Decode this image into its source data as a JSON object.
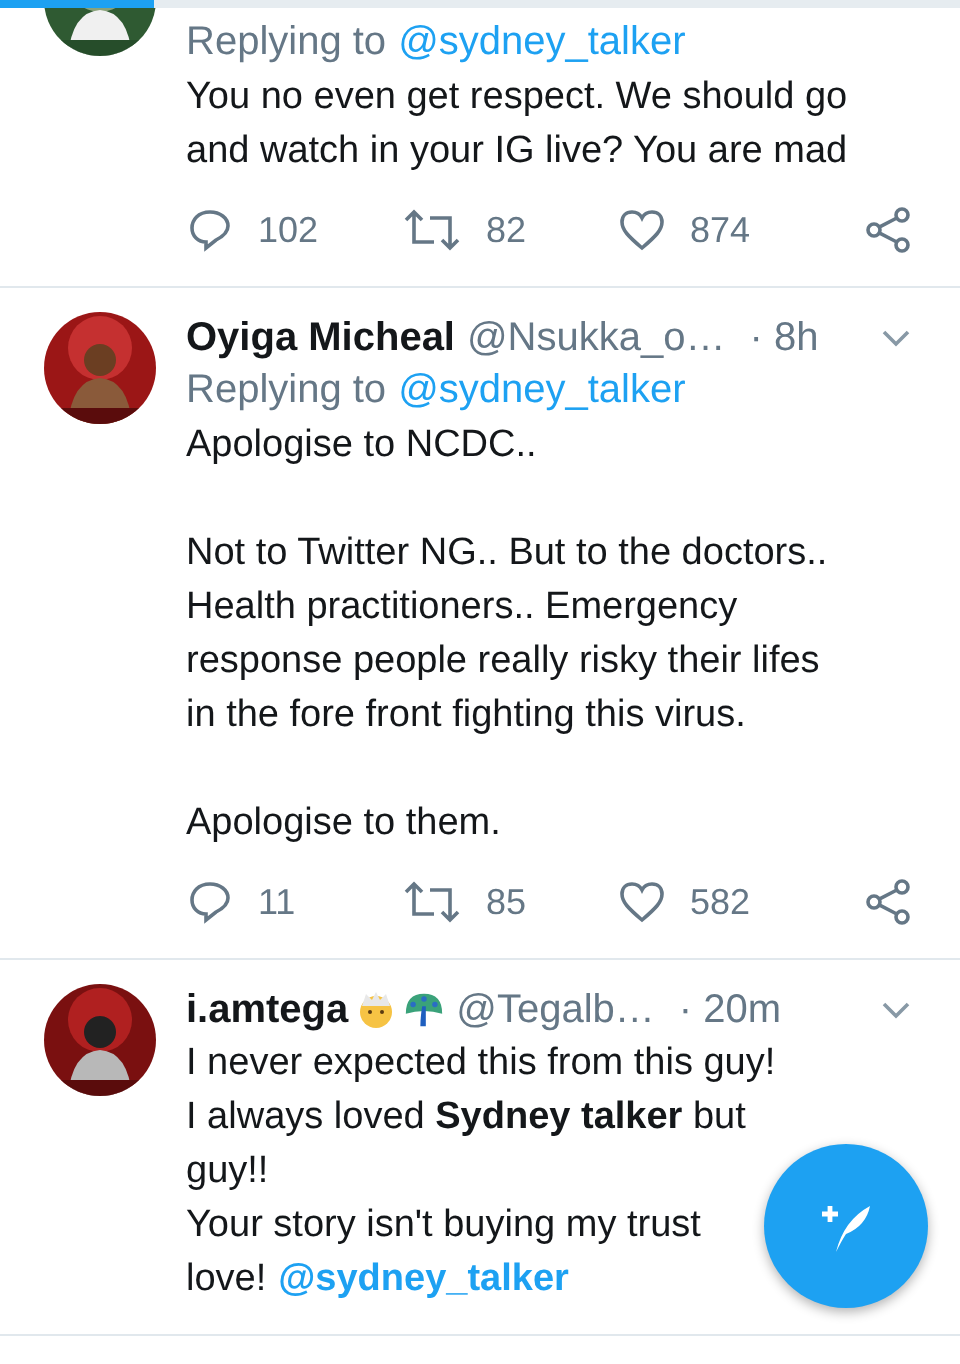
{
  "progress": {
    "level": 0.16
  },
  "tweets": [
    {
      "cut_top": true,
      "replying_label": "Replying to",
      "replying_to": "@sydney_talker",
      "paragraphs": [
        [
          "You no even get respect. We should go",
          "and watch in your IG live? You are mad"
        ]
      ],
      "actions": {
        "replies": "102",
        "retweets": "82",
        "likes": "874"
      }
    },
    {
      "name": "Oyiga Micheal",
      "handle": "@Nsukka_o…",
      "time": "· 8h",
      "replying_label": "Replying to",
      "replying_to": "@sydney_talker",
      "paragraphs": [
        [
          "Apologise to NCDC.."
        ],
        [
          "Not to Twitter NG.. But to the doctors..",
          "Health practitioners.. Emergency",
          "response people really risky their lifes",
          "in the fore front fighting this virus."
        ],
        [
          "Apologise to them."
        ]
      ],
      "actions": {
        "replies": "11",
        "retweets": "85",
        "likes": "582"
      }
    },
    {
      "name": "i.amtega",
      "name_emojis": true,
      "handle": "@Tegalb…",
      "time": "· 20m",
      "paragraphs": [
        [
          "I never expected this from this guy!",
          "I always loved **Sydney talker** but",
          "guy!!",
          "Your story isn't buying my trust"
        ]
      ],
      "tail": {
        "text": "love!",
        "mention": "@sydney_talker"
      }
    }
  ]
}
